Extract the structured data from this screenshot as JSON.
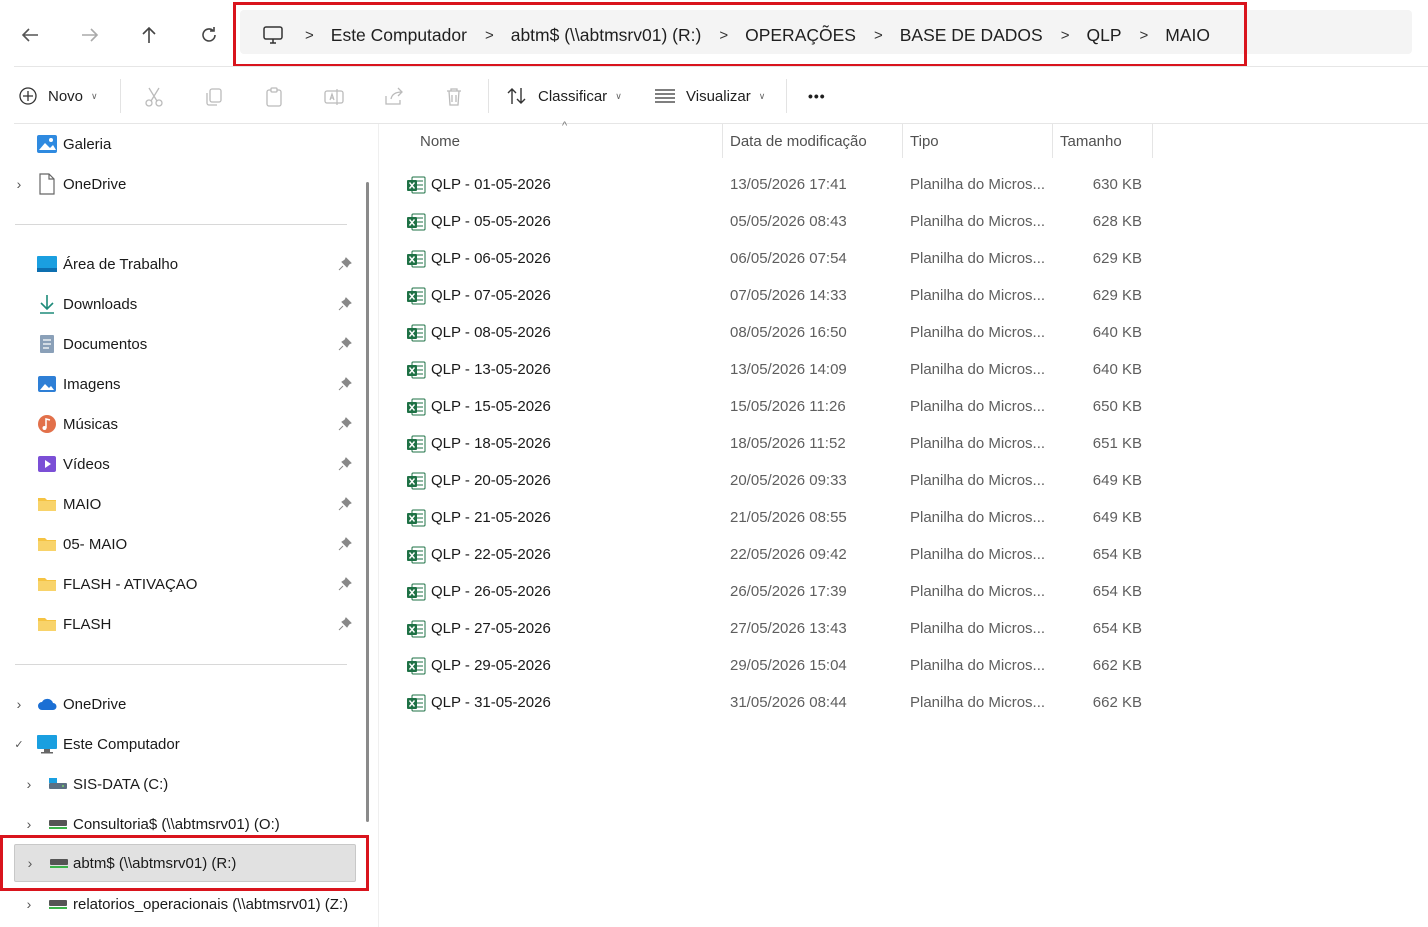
{
  "address_bar": {
    "breadcrumbs": [
      "Este Computador",
      "abtm$ (\\\\abtmsrv01) (R:)",
      "OPERAÇÕES",
      "BASE DE DADOS",
      "QLP",
      "MAIO"
    ],
    "separator": ">"
  },
  "toolbar": {
    "new_label": "Novo",
    "sort_label": "Classificar",
    "view_label": "Visualizar",
    "more_label": "•••"
  },
  "sidebar": {
    "top_items": [
      {
        "label": "Galeria",
        "icon": "gallery-icon"
      },
      {
        "label": "OneDrive",
        "icon": "document-icon",
        "expandable": true
      }
    ],
    "quick_access": [
      {
        "label": "Área de Trabalho",
        "icon": "desktop-icon",
        "pinned": true
      },
      {
        "label": "Downloads",
        "icon": "download-icon",
        "pinned": true
      },
      {
        "label": "Documentos",
        "icon": "documents-icon",
        "pinned": true
      },
      {
        "label": "Imagens",
        "icon": "pictures-icon",
        "pinned": true
      },
      {
        "label": "Músicas",
        "icon": "music-icon",
        "pinned": true
      },
      {
        "label": "Vídeos",
        "icon": "videos-icon",
        "pinned": true
      },
      {
        "label": "MAIO",
        "icon": "folder-icon",
        "pinned": true
      },
      {
        "label": "05- MAIO",
        "icon": "folder-icon",
        "pinned": true
      },
      {
        "label": "FLASH - ATIVAÇAO",
        "icon": "folder-icon",
        "pinned": true
      },
      {
        "label": "FLASH",
        "icon": "folder-icon",
        "pinned": true
      }
    ],
    "tree": [
      {
        "label": "OneDrive",
        "icon": "cloud-icon",
        "expander": "›"
      },
      {
        "label": "Este Computador",
        "icon": "computer-icon",
        "expander": "✓"
      },
      {
        "label": "SIS-DATA (C:)",
        "icon": "local-drive-icon",
        "expander": "›"
      },
      {
        "label": "Consultoria$ (\\\\abtmsrv01) (O:)",
        "icon": "network-drive-icon",
        "expander": "›"
      },
      {
        "label": "abtm$ (\\\\abtmsrv01) (R:)",
        "icon": "network-drive-icon",
        "expander": "›",
        "selected": true
      },
      {
        "label": "relatorios_operacionais (\\\\abtmsrv01) (Z:)",
        "icon": "network-drive-icon",
        "expander": "›"
      }
    ]
  },
  "file_list": {
    "columns": [
      "Nome",
      "Data de modificação",
      "Tipo",
      "Tamanho"
    ],
    "rows": [
      {
        "name": "QLP - 01-05-2026",
        "date": "13/05/2026 17:41",
        "type": "Planilha do Micros...",
        "size": "630 KB"
      },
      {
        "name": "QLP - 05-05-2026",
        "date": "05/05/2026 08:43",
        "type": "Planilha do Micros...",
        "size": "628 KB"
      },
      {
        "name": "QLP - 06-05-2026",
        "date": "06/05/2026 07:54",
        "type": "Planilha do Micros...",
        "size": "629 KB"
      },
      {
        "name": "QLP - 07-05-2026",
        "date": "07/05/2026 14:33",
        "type": "Planilha do Micros...",
        "size": "629 KB"
      },
      {
        "name": "QLP - 08-05-2026",
        "date": "08/05/2026 16:50",
        "type": "Planilha do Micros...",
        "size": "640 KB"
      },
      {
        "name": "QLP - 13-05-2026",
        "date": "13/05/2026 14:09",
        "type": "Planilha do Micros...",
        "size": "640 KB"
      },
      {
        "name": "QLP - 15-05-2026",
        "date": "15/05/2026 11:26",
        "type": "Planilha do Micros...",
        "size": "650 KB"
      },
      {
        "name": "QLP - 18-05-2026",
        "date": "18/05/2026 11:52",
        "type": "Planilha do Micros...",
        "size": "651 KB"
      },
      {
        "name": "QLP - 20-05-2026",
        "date": "20/05/2026 09:33",
        "type": "Planilha do Micros...",
        "size": "649 KB"
      },
      {
        "name": "QLP - 21-05-2026",
        "date": "21/05/2026 08:55",
        "type": "Planilha do Micros...",
        "size": "649 KB"
      },
      {
        "name": "QLP - 22-05-2026",
        "date": "22/05/2026 09:42",
        "type": "Planilha do Micros...",
        "size": "654 KB"
      },
      {
        "name": "QLP - 26-05-2026",
        "date": "26/05/2026 17:39",
        "type": "Planilha do Micros...",
        "size": "654 KB"
      },
      {
        "name": "QLP - 27-05-2026",
        "date": "27/05/2026 13:43",
        "type": "Planilha do Micros...",
        "size": "654 KB"
      },
      {
        "name": "QLP - 29-05-2026",
        "date": "29/05/2026 15:04",
        "type": "Planilha do Micros...",
        "size": "662 KB"
      },
      {
        "name": "QLP - 31-05-2026",
        "date": "31/05/2026 08:44",
        "type": "Planilha do Micros...",
        "size": "662 KB"
      }
    ]
  },
  "colors": {
    "highlight_box": "#d9141d",
    "excel_green": "#1e7145",
    "folder_yellow": "#f5c342",
    "selected_bg": "#e1e1e1"
  }
}
